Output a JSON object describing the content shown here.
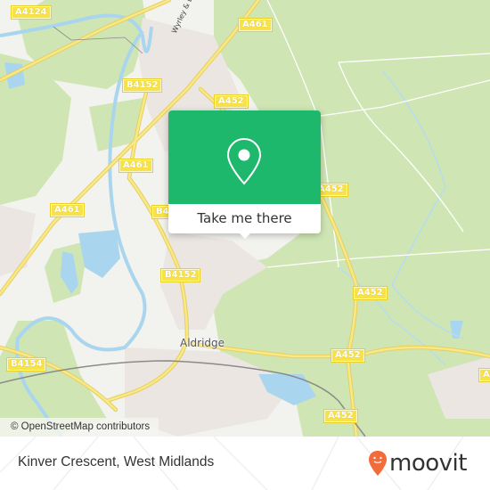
{
  "map": {
    "road_labels": [
      {
        "id": "a4124",
        "text": "A4124"
      },
      {
        "id": "a461-top",
        "text": "A461"
      },
      {
        "id": "b4152-top",
        "text": "B4152"
      },
      {
        "id": "a452-top",
        "text": "A452"
      },
      {
        "id": "a461-left1",
        "text": "A461"
      },
      {
        "id": "a461-left2",
        "text": "A461"
      },
      {
        "id": "b4-partial",
        "text": "B4"
      },
      {
        "id": "a452-right1",
        "text": "A452"
      },
      {
        "id": "b4152-mid",
        "text": "B4152"
      },
      {
        "id": "a452-right2",
        "text": "A452"
      },
      {
        "id": "a452-mid",
        "text": "A452"
      },
      {
        "id": "b4154",
        "text": "B4154"
      },
      {
        "id": "a452-bottom",
        "text": "A452"
      },
      {
        "id": "a4-edge",
        "text": "A4"
      }
    ],
    "street_label": "Wyrley & E",
    "place_label": "Aldridge",
    "attribution": "© OpenStreetMap contributors",
    "colors": {
      "land": "#f2f2ee",
      "green": "#cde6b0",
      "water": "#a9d6ee",
      "road": "#f6e076",
      "rail": "#888888",
      "urban": "#ebe4e0"
    }
  },
  "popup": {
    "icon": "map-pin-icon",
    "action_label": "Take me there",
    "color": "#1db86b"
  },
  "footer": {
    "location_title": "Kinver Crescent, West Midlands",
    "brand": "moovit",
    "brand_color": "#f26b3a"
  }
}
